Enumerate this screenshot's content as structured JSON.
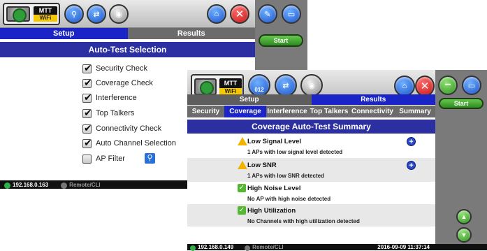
{
  "back": {
    "mtt": {
      "top": "MTT",
      "bottom": "WiFi"
    },
    "tabs": [
      "Setup",
      "Results"
    ],
    "title": "Auto-Test Selection",
    "start_label": "Start",
    "checks": [
      {
        "label": "Security Check",
        "checked": true
      },
      {
        "label": "Coverage Check",
        "checked": true
      },
      {
        "label": "Interference",
        "checked": true
      },
      {
        "label": "Top Talkers",
        "checked": true
      },
      {
        "label": "Connectivity Check",
        "checked": true
      },
      {
        "label": "Auto Channel Selection",
        "checked": true
      },
      {
        "label": "AP Filter",
        "checked": false
      }
    ],
    "status": {
      "ip": "192.168.0.163",
      "remote": "Remote/CLI"
    }
  },
  "front": {
    "mtt": {
      "top": "MTT",
      "bottom": "WiFi"
    },
    "badge": "012",
    "tabs": [
      "Setup",
      "Results"
    ],
    "subtabs": [
      "Security",
      "Coverage",
      "Interference",
      "Top Talkers",
      "Connectivity",
      "Summary"
    ],
    "title": "Coverage Auto-Test Summary",
    "start_label": "Start",
    "rows": [
      {
        "title": "Low Signal Level",
        "detail": "1 APs with low signal level detected",
        "status": "warning",
        "expandable": true
      },
      {
        "title": "Low SNR",
        "detail": "1 APs with low SNR detected",
        "status": "warning",
        "expandable": true
      },
      {
        "title": "High Noise Level",
        "detail": "No AP with high noise detected",
        "status": "ok",
        "expandable": false
      },
      {
        "title": "High Utilization",
        "detail": "No Channels with high utilization  detected",
        "status": "ok",
        "expandable": false
      }
    ],
    "status": {
      "ip": "192.168.0.149",
      "remote": "Remote/CLI",
      "datetime": "2016-09-09 11:37:14"
    }
  },
  "colors": {
    "tab_selected": "#1a24c7",
    "title_bar": "#2b2fa2",
    "start_green": "#2e8a21"
  }
}
